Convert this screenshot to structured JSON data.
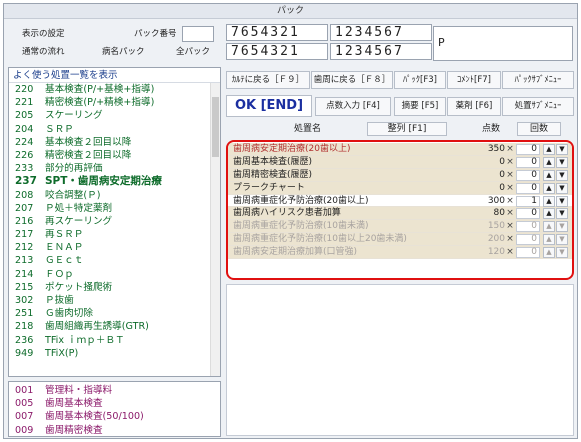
{
  "window": {
    "title": "パック"
  },
  "info": {
    "setting_label": "表示の設定",
    "pack_no_label": "パック番号",
    "normal_flow_label": "通常の流れ",
    "disease_pack_label": "病名パック",
    "full_pack_label": "全パック"
  },
  "patient": {
    "number_top": "7654321",
    "number_top2": "1234567",
    "number_bottom": "7654321",
    "number_bottom2": "1234567",
    "p_label": "P"
  },
  "left_list": {
    "header": "よく使う処置一覧を表示",
    "items": [
      {
        "code": "220",
        "label": "基本検査(P/+基検+指導)"
      },
      {
        "code": "221",
        "label": "精密検査(P/+精検+指導)"
      },
      {
        "code": "205",
        "label": "スケーリング"
      },
      {
        "code": "204",
        "label": "ＳＲＰ"
      },
      {
        "code": "224",
        "label": "基本検査２回目以降"
      },
      {
        "code": "226",
        "label": "精密検査２回目以降"
      },
      {
        "code": "233",
        "label": "部分的再評価"
      },
      {
        "code": "237",
        "label": "SPT・歯周病安定期治療"
      },
      {
        "code": "208",
        "label": "咬合調整(Ｐ)"
      },
      {
        "code": "207",
        "label": "Ｐ処＋特定薬剤"
      },
      {
        "code": "216",
        "label": "再スケーリング"
      },
      {
        "code": "217",
        "label": "再ＳＲＰ"
      },
      {
        "code": "212",
        "label": "ＥＮＡＰ"
      },
      {
        "code": "213",
        "label": "ＧＥｃｔ"
      },
      {
        "code": "214",
        "label": "ＦＯｐ"
      },
      {
        "code": "215",
        "label": "ポケット掻爬術"
      },
      {
        "code": "302",
        "label": "Ｐ抜歯"
      },
      {
        "code": "251",
        "label": "Ｇ歯肉切除"
      },
      {
        "code": "218",
        "label": "歯周組織再生誘導(GTR)"
      },
      {
        "code": "236",
        "label": "TFix ｉｍｐ＋ＢＴ"
      },
      {
        "code": "949",
        "label": "TFiX(P)"
      }
    ]
  },
  "lower_list": {
    "items": [
      {
        "code": "001",
        "label": "管理料・指導料"
      },
      {
        "code": "005",
        "label": "歯周基本検査"
      },
      {
        "code": "007",
        "label": "歯周基本検査(50/100)"
      },
      {
        "code": "009",
        "label": "歯周精密検査"
      }
    ]
  },
  "toolbar": {
    "karte_back": "ｶﾙﾃに戻る［Ｆ９］",
    "perio_back": "歯周に戻る［Ｆ８］",
    "pack": "ﾊﾟｯｸ[F3]",
    "comment": "ｺﾒﾝﾄ[F7]",
    "pack_submenu": "ﾊﾟｯｸｻﾌﾞﾒﾆｭｰ",
    "ok": "OK [END]",
    "points_input": "点数入力 [F4]",
    "summary": "摘要 [F5]",
    "medicine": "薬剤 [F6]",
    "procedure_submenu": "処置ｻﾌﾞﾒﾆｭｰ"
  },
  "table": {
    "headers": {
      "name": "処置名",
      "sort": "整列 [F1]",
      "points": "点数",
      "count": "回数"
    },
    "rows": [
      {
        "name": "歯周病安定期治療(20歯以上)",
        "points": "350",
        "qty": "0",
        "style": "tan"
      },
      {
        "name": "歯周基本検査(履歴)",
        "points": "0",
        "qty": "0",
        "style": "tan"
      },
      {
        "name": "歯周精密検査(履歴)",
        "points": "0",
        "qty": "0",
        "style": "tan"
      },
      {
        "name": "プラークチャート",
        "points": "0",
        "qty": "0",
        "style": "tan"
      },
      {
        "name": "歯周病重症化予防治療(20歯以上)",
        "points": "300",
        "qty": "1",
        "style": "white"
      },
      {
        "name": "歯周病ハイリスク患者加算",
        "points": "80",
        "qty": "0",
        "style": "tan"
      },
      {
        "name": "歯周病重症化予防治療(10歯未満)",
        "points": "150",
        "qty": "0",
        "style": "grey"
      },
      {
        "name": "歯周病重症化予防治療(10歯以上20歯未満)",
        "points": "200",
        "qty": "0",
        "style": "grey"
      },
      {
        "name": "歯周病安定期治療加算(口管強)",
        "points": "120",
        "qty": "0",
        "style": "grey"
      }
    ],
    "times": "×",
    "up_arrow": "▲",
    "down_arrow": "▼"
  },
  "colors": {
    "highlight_red": "#e01010",
    "ok_blue": "#1b2fa0",
    "list_green": "#0d6b2a",
    "list_purple": "#8b1a6a"
  }
}
